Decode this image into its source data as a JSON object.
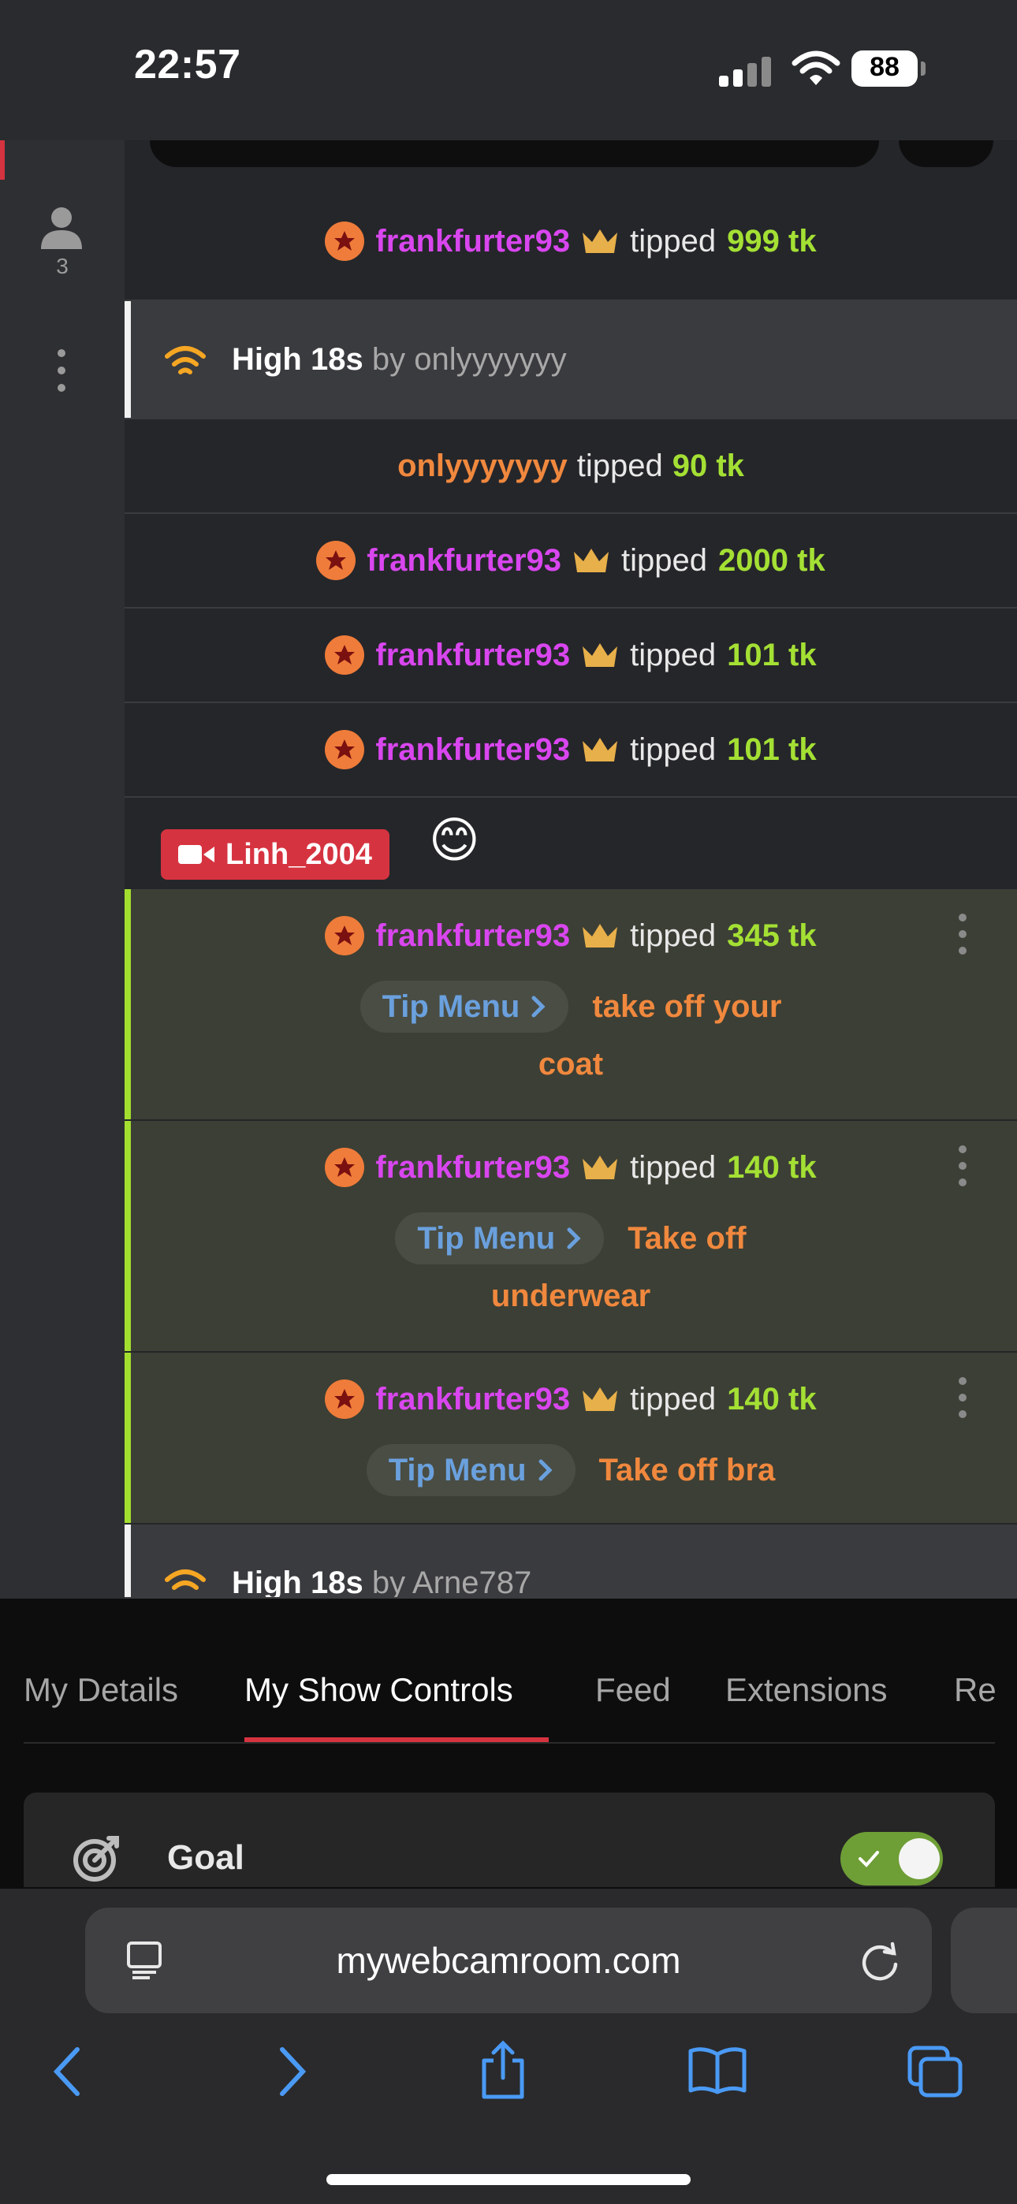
{
  "status_bar": {
    "time": "22:57",
    "battery": "88"
  },
  "left_rail": {
    "user_count": "3"
  },
  "chat": {
    "row1": {
      "user": "frankfurter93",
      "verb": "tipped",
      "amount": "999 tk"
    },
    "notice1": {
      "title": "High 18s",
      "by": "by onlyyyyyyy"
    },
    "row2": {
      "user": "onlyyyyyyy",
      "verb": "tipped",
      "amount": "90 tk"
    },
    "row3": {
      "user": "frankfurter93",
      "verb": "tipped",
      "amount": "2000 tk"
    },
    "row4": {
      "user": "frankfurter93",
      "verb": "tipped",
      "amount": "101 tk"
    },
    "row5": {
      "user": "frankfurter93",
      "verb": "tipped",
      "amount": "101 tk"
    },
    "broadcaster": {
      "name": "Linh_2004",
      "emoji": "😊"
    },
    "tip1": {
      "user": "frankfurter93",
      "verb": "tipped",
      "amount": "345 tk",
      "menu": "Tip Menu",
      "action_line1": "take off your",
      "action_line2": "coat"
    },
    "tip2": {
      "user": "frankfurter93",
      "verb": "tipped",
      "amount": "140 tk",
      "menu": "Tip Menu",
      "action_line1": "Take off",
      "action_line2": "underwear"
    },
    "tip3": {
      "user": "frankfurter93",
      "verb": "tipped",
      "amount": "140 tk",
      "menu": "Tip Menu",
      "action_line1": "Take off bra"
    },
    "notice2": {
      "title": "High 18s",
      "by": "by Arne787"
    }
  },
  "tabs": {
    "items": [
      {
        "label": "My Details"
      },
      {
        "label": "My Show Controls"
      },
      {
        "label": "Feed"
      },
      {
        "label": "Extensions"
      },
      {
        "label": "Re"
      }
    ],
    "active": "My Show Controls"
  },
  "goal": {
    "label": "Goal",
    "enabled": true
  },
  "browser": {
    "url": "mywebcamroom.com"
  },
  "colors": {
    "accent_red": "#d63340",
    "username_pink": "#d946ef",
    "token_green": "#a4e034",
    "action_orange": "#f0883e",
    "tip_menu_blue": "#6aa0dd"
  }
}
